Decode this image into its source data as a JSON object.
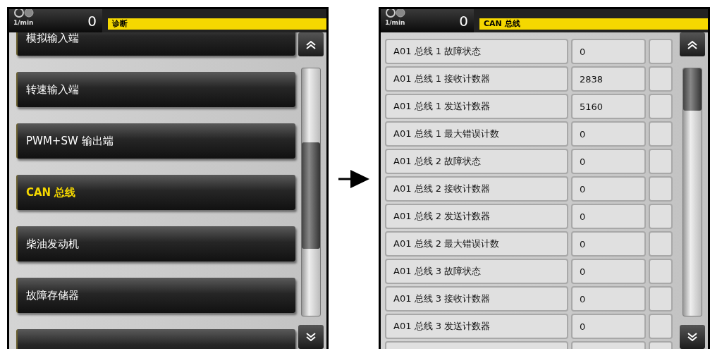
{
  "left_panel": {
    "header": {
      "speed_value": "0",
      "speed_unit": "1/min",
      "title": "诊断"
    },
    "menu_items": [
      {
        "label": "模拟输入端",
        "selected": false
      },
      {
        "label": "转速输入端",
        "selected": false
      },
      {
        "label": "PWM+SW 输出端",
        "selected": false
      },
      {
        "label": "CAN 总线",
        "selected": true
      },
      {
        "label": "柴油发动机",
        "selected": false
      },
      {
        "label": "故障存储器",
        "selected": false
      }
    ]
  },
  "right_panel": {
    "header": {
      "speed_value": "0",
      "speed_unit": "1/min",
      "title": "CAN 总线"
    },
    "rows": [
      {
        "label": "A01 总线 1 故障状态",
        "value": "0"
      },
      {
        "label": "A01 总线 1 接收计数器",
        "value": "2838"
      },
      {
        "label": "A01 总线 1 发送计数器",
        "value": "5160"
      },
      {
        "label": "A01 总线 1 最大错误计数",
        "value": "0"
      },
      {
        "label": "A01 总线 2 故障状态",
        "value": "0"
      },
      {
        "label": "A01 总线 2 接收计数器",
        "value": "0"
      },
      {
        "label": "A01 总线 2 发送计数器",
        "value": "0"
      },
      {
        "label": "A01 总线 2 最大错误计数",
        "value": "0"
      },
      {
        "label": "A01 总线 3 故障状态",
        "value": "0"
      },
      {
        "label": "A01 总线 3 接收计数器",
        "value": "0"
      },
      {
        "label": "A01 总线 3 发送计数器",
        "value": "0"
      }
    ]
  }
}
